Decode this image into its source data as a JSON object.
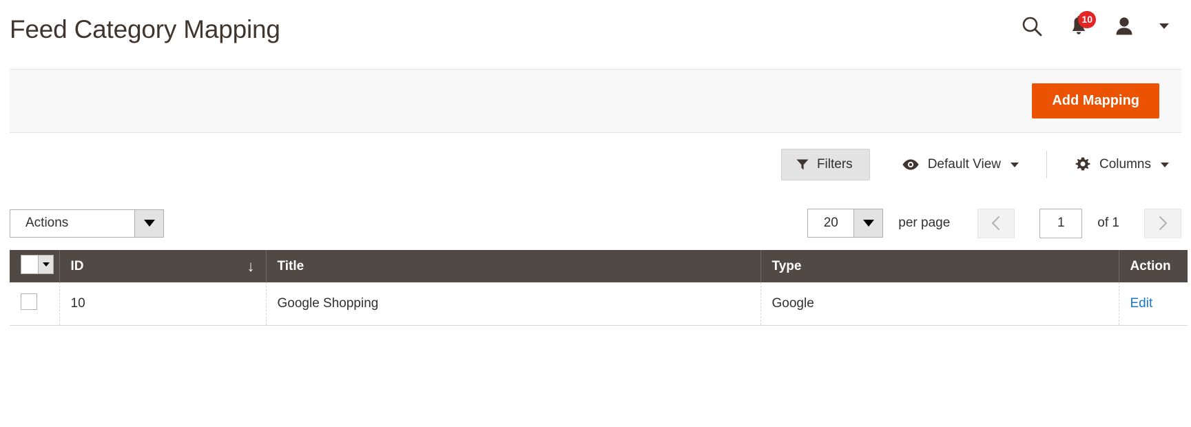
{
  "header": {
    "title": "Feed Category Mapping",
    "search_icon": "search-icon",
    "notifications_icon": "bell-icon",
    "notifications_count": "10",
    "user_icon": "user-icon",
    "user_menu_caret": "chevron-down-icon"
  },
  "page_actions": {
    "add_mapping_label": "Add Mapping",
    "primary_color": "#eb5202"
  },
  "toolbar": {
    "filters_label": "Filters",
    "filters_icon": "funnel-icon",
    "view_label": "Default View",
    "view_icon": "eye-icon",
    "columns_label": "Columns",
    "columns_icon": "gear-icon"
  },
  "controls": {
    "actions_label": "Actions",
    "per_page_value": "20",
    "per_page_label": "per page",
    "current_page": "1",
    "pages_total": "of 1",
    "prev_icon": "chevron-left-icon",
    "next_icon": "chevron-right-icon"
  },
  "grid": {
    "header_bg": "#514943",
    "columns": [
      {
        "key": "check",
        "label": ""
      },
      {
        "key": "id",
        "label": "ID",
        "sort": "↓"
      },
      {
        "key": "title",
        "label": "Title"
      },
      {
        "key": "type",
        "label": "Type"
      },
      {
        "key": "action",
        "label": "Action"
      }
    ],
    "rows": [
      {
        "id": "10",
        "title": "Google Shopping",
        "type": "Google",
        "action_label": "Edit",
        "action_color": "#1979c3"
      }
    ]
  }
}
